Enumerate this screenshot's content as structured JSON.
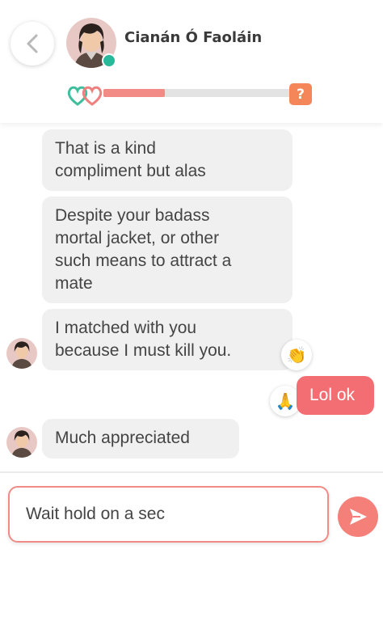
{
  "header": {
    "contact_name": "Cianán Ó Faoláin",
    "status": "online",
    "affinity_progress": 0.32,
    "help_label": "?"
  },
  "messages": [
    {
      "sender": "them",
      "text_lines": [
        "That is a kind",
        "compliment but alas"
      ]
    },
    {
      "sender": "them",
      "text_lines": [
        "Despite your badass",
        "mortal jacket, or other",
        "such means to attract a",
        "mate"
      ]
    },
    {
      "sender": "them",
      "text_lines": [
        "I matched with you",
        "because I must kill you."
      ],
      "reaction": "clapping-hands"
    },
    {
      "sender": "me",
      "text_lines": [
        "Lol ok"
      ],
      "reaction": "folded-hands"
    },
    {
      "sender": "them",
      "text_lines": [
        "Much appreciated"
      ]
    }
  ],
  "composer": {
    "value": "Wait hold on a sec"
  },
  "colors": {
    "accent": "#f36e73",
    "progress": "#f28b86",
    "online": "#29b89a",
    "help": "#f4865a",
    "incoming_bubble": "#f0f0f0"
  },
  "icons": {
    "back": "chevron-left-icon",
    "affinity": "hearts-icon",
    "send": "send-icon",
    "reaction_clap": "👏",
    "reaction_pray": "🙏"
  }
}
